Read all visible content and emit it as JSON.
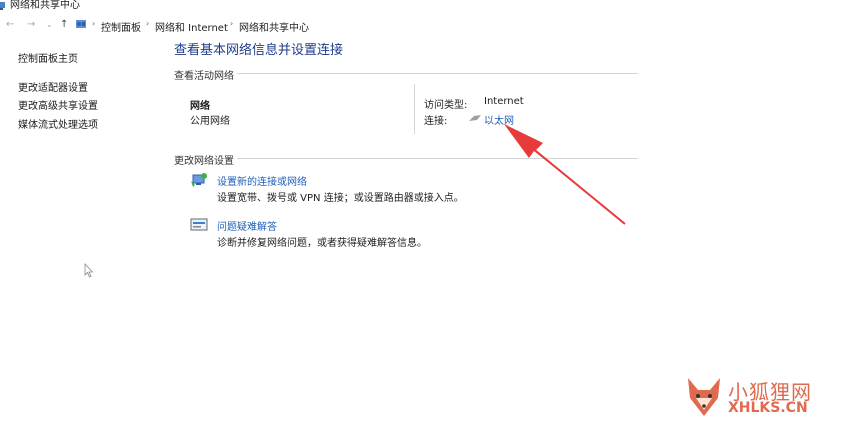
{
  "window": {
    "title": "网络和共享中心"
  },
  "address_bar": {
    "breadcrumbs": [
      "控制面板",
      "网络和 Internet",
      "网络和共享中心"
    ]
  },
  "sidebar": {
    "items": [
      {
        "label": "控制面板主页"
      },
      {
        "label": "更改适配器设置"
      },
      {
        "label": "更改高级共享设置"
      },
      {
        "label": "媒体流式处理选项"
      }
    ]
  },
  "main": {
    "heading": "查看基本网络信息并设置连接",
    "active_section_title": "查看活动网络",
    "network": {
      "name": "网络",
      "type": "公用网络",
      "access_type_label": "访问类型:",
      "access_type_value": "Internet",
      "connection_label": "连接:",
      "connection_value": "以太网"
    },
    "change_section_title": "更改网络设置",
    "tasks": [
      {
        "title": "设置新的连接或网络",
        "desc": "设置宽带、拨号或 VPN 连接；或设置路由器或接入点。",
        "icon": "network-setup-icon"
      },
      {
        "title": "问题疑难解答",
        "desc": "诊断并修复网络问题，或者获得疑难解答信息。",
        "icon": "troubleshoot-icon"
      }
    ]
  },
  "watermark": {
    "cn": "小狐狸网",
    "en": "XHLKS.CN"
  },
  "colors": {
    "link": "#1f5fb8",
    "heading": "#1e3d8a",
    "annotation_arrow": "#e83a3a",
    "watermark": "#e06a4e"
  }
}
